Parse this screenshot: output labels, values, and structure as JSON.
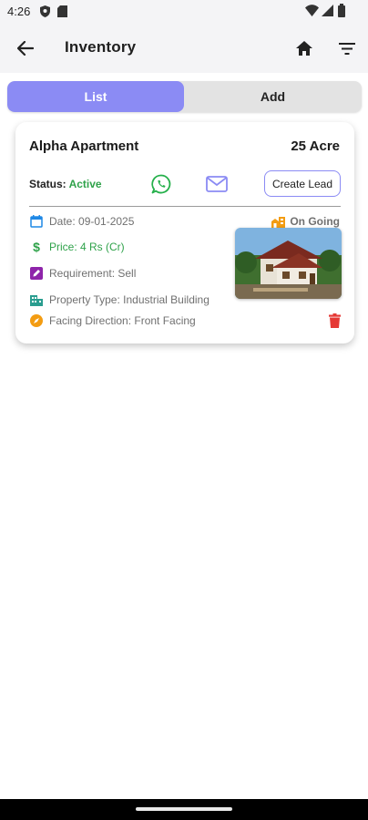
{
  "status_bar": {
    "time": "4:26"
  },
  "app_bar": {
    "title": "Inventory",
    "icons": {
      "back": "arrow-left-icon",
      "home": "home-icon",
      "filter": "filter-icon"
    }
  },
  "tabs": [
    {
      "label": "List",
      "selected": true
    },
    {
      "label": "Add",
      "selected": false
    }
  ],
  "colors": {
    "accent": "#8b8bf4",
    "active_green": "#2fa24a",
    "whatsapp": "#25b04b",
    "ongoing_orange": "#f39c12",
    "delete_red": "#e53935"
  },
  "listing": {
    "name": "Alpha Apartment",
    "area": "25 Acre",
    "status_label": "Status:",
    "status_value": "Active",
    "create_lead_label": "Create Lead",
    "progress": "On Going",
    "date": "Date: 09-01-2025",
    "price": "Price: 4 Rs (Cr)",
    "requirement": "Requirement: Sell",
    "property_type": "Property Type: Industrial Building",
    "facing": "Facing Direction: Front Facing"
  }
}
